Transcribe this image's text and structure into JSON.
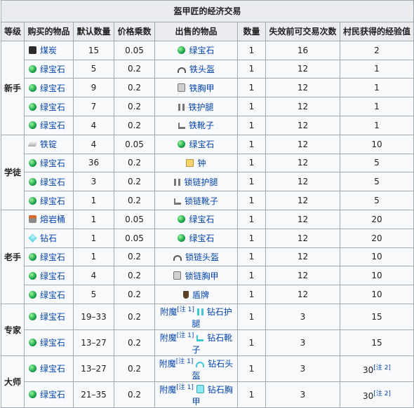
{
  "title": "盔甲匠的经济交易",
  "headers": [
    "等级",
    "购买的物品",
    "默认数量",
    "价格乘数",
    "出售的物品",
    "数量",
    "失效前可交易次数",
    "村民获得的经验值"
  ],
  "levels": [
    {
      "name": "新手",
      "rows": [
        {
          "buy": "煤炭",
          "buy_icon": "coal-icon",
          "qty": "15",
          "mult": "0.05",
          "sell": "绿宝石",
          "sell_icon": "emerald-icon",
          "sell_qty": "1",
          "uses": "16",
          "xp": "2"
        },
        {
          "buy": "绿宝石",
          "buy_icon": "emerald-icon",
          "qty": "5",
          "mult": "0.2",
          "sell": "铁头盔",
          "sell_icon": "iron-helmet-icon",
          "sell_qty": "1",
          "uses": "12",
          "xp": "1"
        },
        {
          "buy": "绿宝石",
          "buy_icon": "emerald-icon",
          "qty": "9",
          "mult": "0.2",
          "sell": "铁胸甲",
          "sell_icon": "iron-chestplate-icon",
          "sell_qty": "1",
          "uses": "12",
          "xp": "1"
        },
        {
          "buy": "绿宝石",
          "buy_icon": "emerald-icon",
          "qty": "7",
          "mult": "0.2",
          "sell": "铁护腿",
          "sell_icon": "iron-leggings-icon",
          "sell_qty": "1",
          "uses": "12",
          "xp": "1"
        },
        {
          "buy": "绿宝石",
          "buy_icon": "emerald-icon",
          "qty": "4",
          "mult": "0.2",
          "sell": "铁靴子",
          "sell_icon": "iron-boots-icon",
          "sell_qty": "1",
          "uses": "12",
          "xp": "1"
        }
      ]
    },
    {
      "name": "学徒",
      "rows": [
        {
          "buy": "铁锭",
          "buy_icon": "iron-ingot-icon",
          "qty": "4",
          "mult": "0.05",
          "sell": "绿宝石",
          "sell_icon": "emerald-icon",
          "sell_qty": "1",
          "uses": "12",
          "xp": "10"
        },
        {
          "buy": "绿宝石",
          "buy_icon": "emerald-icon",
          "qty": "36",
          "mult": "0.2",
          "sell": "钟",
          "sell_icon": "bell-icon",
          "sell_qty": "1",
          "uses": "12",
          "xp": "5"
        },
        {
          "buy": "绿宝石",
          "buy_icon": "emerald-icon",
          "qty": "3",
          "mult": "0.2",
          "sell": "锁链护腿",
          "sell_icon": "chainmail-leggings-icon",
          "sell_qty": "1",
          "uses": "12",
          "xp": "5"
        },
        {
          "buy": "绿宝石",
          "buy_icon": "emerald-icon",
          "qty": "1",
          "mult": "0.2",
          "sell": "锁链靴子",
          "sell_icon": "chainmail-boots-icon",
          "sell_qty": "1",
          "uses": "12",
          "xp": "5"
        }
      ]
    },
    {
      "name": "老手",
      "rows": [
        {
          "buy": "熔岩桶",
          "buy_icon": "lava-bucket-icon",
          "qty": "1",
          "mult": "0.05",
          "sell": "绿宝石",
          "sell_icon": "emerald-icon",
          "sell_qty": "1",
          "uses": "12",
          "xp": "20"
        },
        {
          "buy": "钻石",
          "buy_icon": "diamond-icon",
          "qty": "1",
          "mult": "0.05",
          "sell": "绿宝石",
          "sell_icon": "emerald-icon",
          "sell_qty": "1",
          "uses": "12",
          "xp": "20"
        },
        {
          "buy": "绿宝石",
          "buy_icon": "emerald-icon",
          "qty": "1",
          "mult": "0.2",
          "sell": "锁链头盔",
          "sell_icon": "chainmail-helmet-icon",
          "sell_qty": "1",
          "uses": "12",
          "xp": "10"
        },
        {
          "buy": "绿宝石",
          "buy_icon": "emerald-icon",
          "qty": "4",
          "mult": "0.2",
          "sell": "锁链胸甲",
          "sell_icon": "chainmail-chestplate-icon",
          "sell_qty": "1",
          "uses": "12",
          "xp": "10"
        },
        {
          "buy": "绿宝石",
          "buy_icon": "emerald-icon",
          "qty": "5",
          "mult": "0.2",
          "sell": "盾牌",
          "sell_icon": "shield-icon",
          "sell_qty": "1",
          "uses": "12",
          "xp": "10"
        }
      ]
    },
    {
      "name": "专家",
      "rows": [
        {
          "buy": "绿宝石",
          "buy_icon": "emerald-icon",
          "qty": "19–33",
          "mult": "0.2",
          "ench": "附魔",
          "note": "[注 1]",
          "sell": "钻石护腿",
          "sell_icon": "diamond-leggings-icon",
          "sell_qty": "1",
          "uses": "3",
          "xp": "15"
        },
        {
          "buy": "绿宝石",
          "buy_icon": "emerald-icon",
          "qty": "13–27",
          "mult": "0.2",
          "ench": "附魔",
          "note": "[注 1]",
          "sell": "钻石靴子",
          "sell_icon": "diamond-boots-icon",
          "sell_qty": "1",
          "uses": "3",
          "xp": "15"
        }
      ]
    },
    {
      "name": "大师",
      "rows": [
        {
          "buy": "绿宝石",
          "buy_icon": "emerald-icon",
          "qty": "13–27",
          "mult": "0.2",
          "ench": "附魔",
          "note": "[注 1]",
          "sell": "钻石头盔",
          "sell_icon": "diamond-helmet-icon",
          "sell_qty": "1",
          "uses": "3",
          "xp": "30",
          "xp_note": "[注 2]"
        },
        {
          "buy": "绿宝石",
          "buy_icon": "emerald-icon",
          "qty": "21–35",
          "mult": "0.2",
          "ench": "附魔",
          "note": "[注 1]",
          "sell": "钻石胸甲",
          "sell_icon": "diamond-chestplate-icon",
          "sell_qty": "1",
          "uses": "3",
          "xp": "30",
          "xp_note": "[注 2]"
        }
      ]
    }
  ]
}
